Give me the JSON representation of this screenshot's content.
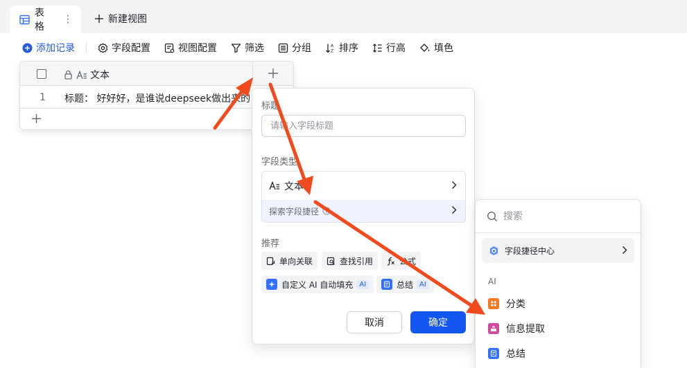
{
  "tabs": {
    "active_label": "表格",
    "new_view_label": "新建视图"
  },
  "toolbar": {
    "add_record": "添加记录",
    "field_config": "字段配置",
    "view_config": "视图配置",
    "filter": "筛选",
    "group": "分组",
    "sort": "排序",
    "row_height": "行高",
    "fill": "填色"
  },
  "grid": {
    "column_name": "文本",
    "rows": [
      {
        "num": "1",
        "text": "标题：  好好好，是谁说deepseek做出来的"
      }
    ]
  },
  "field_panel": {
    "title_label": "标题",
    "title_placeholder": "请输入字段标题",
    "type_label": "字段类型",
    "type_value": "文本",
    "shortcut_label": "探索字段捷径",
    "recommend_label": "推荐",
    "chips": [
      "单向关联",
      "查找引用",
      "公式",
      "自定义 AI 自动填充",
      "总结"
    ],
    "ai_badge": "AI",
    "cancel": "取消",
    "confirm": "确定"
  },
  "dropdown": {
    "search_placeholder": "搜索",
    "center_label": "字段捷径中心",
    "section_ai": "AI",
    "items": [
      "分类",
      "信息提取",
      "总结"
    ]
  },
  "colors": {
    "primary": "#1456f0",
    "link": "#245bdb",
    "arrow": "#f04a1d",
    "orange_icon": "#f5761f",
    "pink_icon": "#d14c9f",
    "blue_icon": "#3370ff"
  }
}
